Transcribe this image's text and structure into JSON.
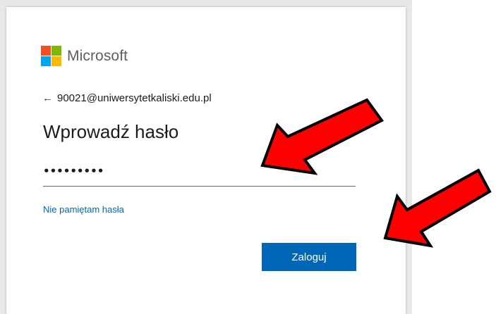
{
  "brand": {
    "name": "Microsoft",
    "logo_colors": [
      "#f25022",
      "#7fba00",
      "#00a4ef",
      "#ffb900"
    ]
  },
  "identity": {
    "back_icon": "arrow-left-icon",
    "email": "90021@uniwersytetkaliski.edu.pl"
  },
  "form": {
    "title": "Wprowadź hasło",
    "password_value": "•••••••••",
    "forgot_link": "Nie pamiętam hasła",
    "submit_label": "Zaloguj"
  },
  "colors": {
    "accent": "#0067b8",
    "annotation_arrow": "#ff0000"
  }
}
